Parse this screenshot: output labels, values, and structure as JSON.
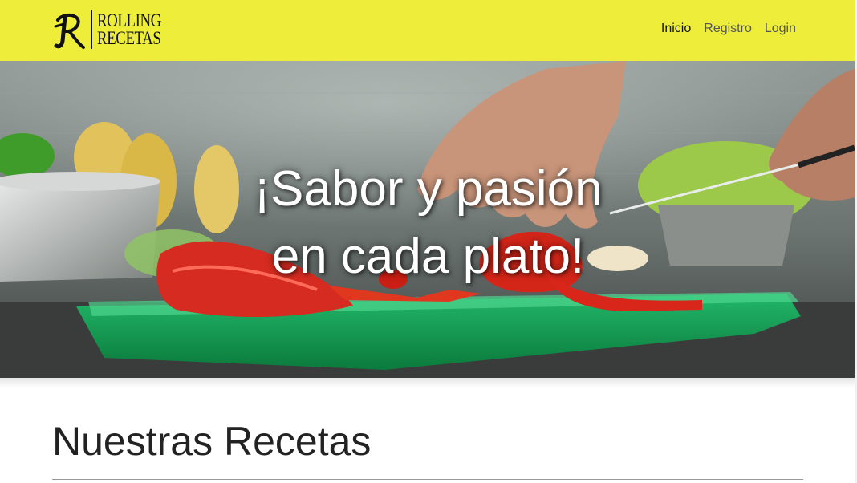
{
  "brand": {
    "logo_letter": "R",
    "name_line1": "ROLLING",
    "name_line2": "RECETAS"
  },
  "nav": {
    "items": [
      {
        "label": "Inicio",
        "active": true
      },
      {
        "label": "Registro",
        "active": false
      },
      {
        "label": "Login",
        "active": false
      }
    ]
  },
  "hero": {
    "line1": "¡Sabor y pasión",
    "line2": "en cada plato!",
    "image": "kitchen cutting board with sliced red peppers"
  },
  "section": {
    "title": "Nuestras Recetas"
  },
  "colors": {
    "navbar": "#eeee3a",
    "nav_active": "#111111",
    "nav_inactive": "#555555"
  }
}
